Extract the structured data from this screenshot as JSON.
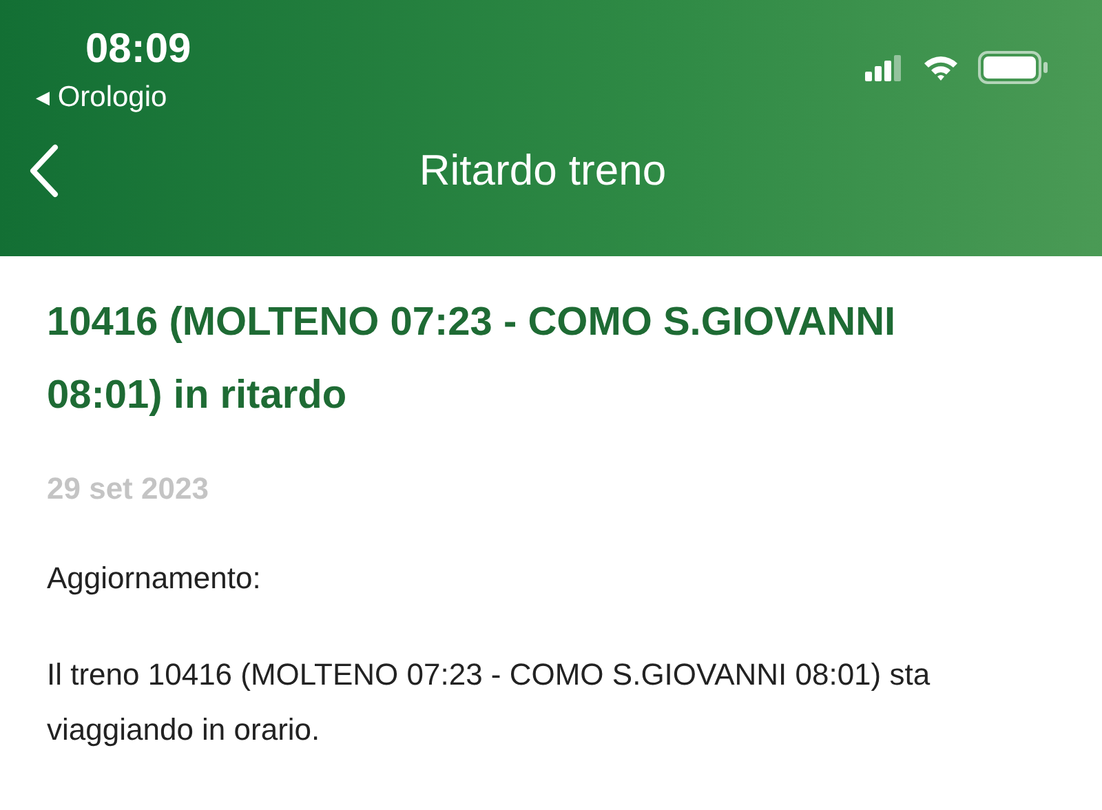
{
  "status_bar": {
    "time": "08:09",
    "back_app_arrow": "◀",
    "back_app": "Orologio"
  },
  "nav": {
    "title": "Ritardo treno"
  },
  "article": {
    "title": "10416 (MOLTENO 07:23 - COMO S.GIOVANNI 08:01) in ritardo",
    "date": "29 set 2023",
    "heading": "Aggiornamento:",
    "body": "Il treno 10416 (MOLTENO 07:23 - COMO S.GIOVANNI 08:01) sta viaggiando in orario."
  }
}
